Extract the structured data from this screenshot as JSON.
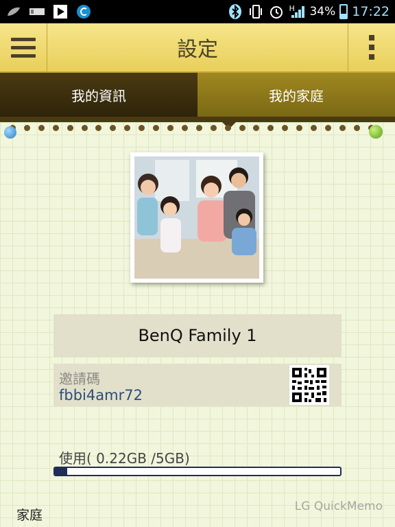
{
  "status_bar": {
    "battery_percent": "34%",
    "battery_level": 0.34,
    "time": "17:22",
    "network_label": "H"
  },
  "title_bar": {
    "title": "設定"
  },
  "tabs": [
    {
      "label": "我的資訊",
      "active": false
    },
    {
      "label": "我的家庭",
      "active": true
    }
  ],
  "family": {
    "name": "BenQ Family 1",
    "invite_label": "邀請碼",
    "invite_code": "fbbi4amr72"
  },
  "usage": {
    "label": "使用( 0.22GB /5GB)",
    "used_gb": 0.22,
    "total_gb": 5
  },
  "footer": {
    "section_label": "家庭",
    "watermark": "LG QuickMemo"
  }
}
